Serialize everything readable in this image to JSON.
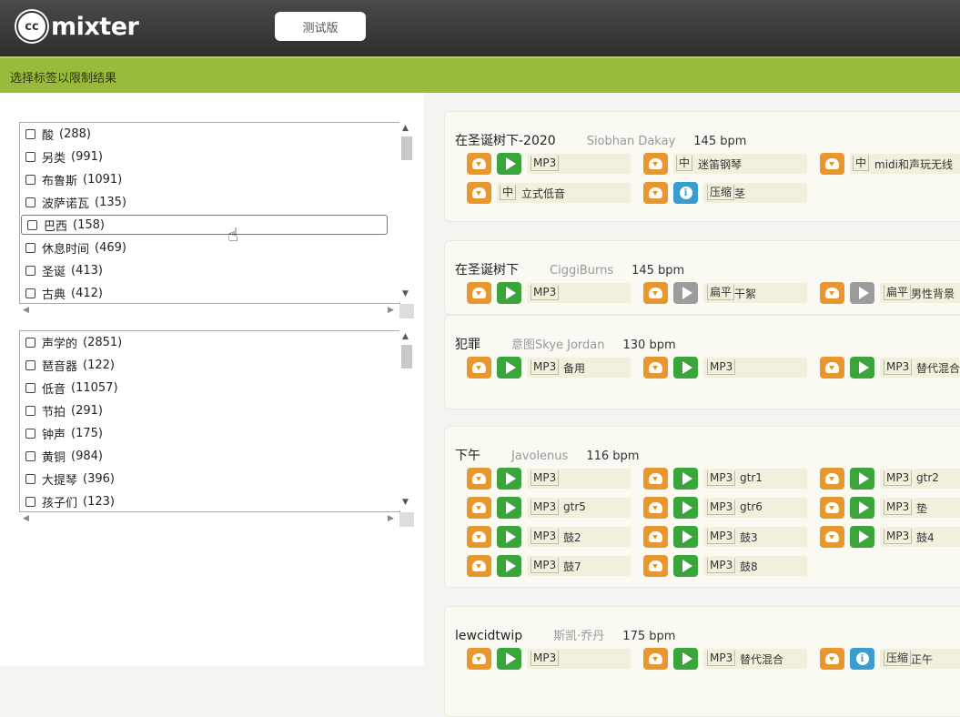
{
  "header": {
    "logo_cc": "cc",
    "logo_word": "mixter",
    "beta_button": "测试版"
  },
  "tagbar": {
    "label": "选择标签以限制结果"
  },
  "tag_list_1": [
    {
      "name": "酸",
      "count": "(288)"
    },
    {
      "name": "另类",
      "count": "(991)"
    },
    {
      "name": "布鲁斯",
      "count": "(1091)"
    },
    {
      "name": "波萨诺瓦",
      "count": "(135)"
    },
    {
      "name": "巴西",
      "count": "(158)"
    },
    {
      "name": "休息时间",
      "count": "(469)"
    },
    {
      "name": "圣诞",
      "count": "(413)"
    },
    {
      "name": "古典",
      "count": "(412)"
    }
  ],
  "tag_list_2": [
    {
      "name": "声学的",
      "count": "(2851)"
    },
    {
      "name": "琶音器",
      "count": "(122)"
    },
    {
      "name": "低音",
      "count": "(11057)"
    },
    {
      "name": "节拍",
      "count": "(291)"
    },
    {
      "name": "钟声",
      "count": "(175)"
    },
    {
      "name": "黄铜",
      "count": "(984)"
    },
    {
      "name": "大提琴",
      "count": "(396)"
    },
    {
      "name": "孩子们",
      "count": "(123)"
    }
  ],
  "icons": {
    "download": "download-cloud-icon",
    "play": "play-icon",
    "info": "info-icon",
    "scroll_up": "scroll-up-arrow-icon",
    "scroll_down": "scroll-down-arrow-icon",
    "cursor": "hand-pointer-icon"
  },
  "colors": {
    "download": "#e8962e",
    "play": "#3aa53a",
    "play_disabled": "#9c9c9c",
    "info": "#3a9dd1",
    "tagbar": "#9aba3c"
  },
  "tracks": [
    {
      "title": "在圣诞树下-2020",
      "artist": "Siobhan Dakay",
      "bpm": "145 bpm",
      "files": [
        {
          "play": "play",
          "format": "MP3",
          "label": ""
        },
        {
          "play": "none",
          "format": "中",
          "label": "迷笛钢琴"
        },
        {
          "play": "none",
          "format": "中",
          "label": "midi和声玩无线"
        },
        {
          "play": "none",
          "format": "中",
          "label": "立式低音"
        },
        {
          "play": "info",
          "format": "压缩",
          "label": "茎"
        }
      ]
    },
    {
      "title": "在圣诞树下",
      "artist": "CiggiBurns",
      "bpm": "145 bpm",
      "files": [
        {
          "play": "play",
          "format": "MP3",
          "label": ""
        },
        {
          "play": "gray",
          "format": "扁平",
          "label": "干絮"
        },
        {
          "play": "gray",
          "format": "扁平",
          "label": "男性背景"
        }
      ]
    },
    {
      "title": "犯罪",
      "artist": "意图Skye Jordan",
      "bpm": "130 bpm",
      "files": [
        {
          "play": "play",
          "format": "MP3",
          "label": "备用"
        },
        {
          "play": "play",
          "format": "MP3",
          "label": ""
        },
        {
          "play": "play",
          "format": "MP3",
          "label": "替代混合"
        }
      ]
    },
    {
      "title": "下午",
      "artist": "Javolenus",
      "bpm": "116 bpm",
      "files": [
        {
          "play": "play",
          "format": "MP3",
          "label": ""
        },
        {
          "play": "play",
          "format": "MP3",
          "label": "gtr1"
        },
        {
          "play": "play",
          "format": "MP3",
          "label": "gtr2"
        },
        {
          "play": "play",
          "format": "MP3",
          "label": "gtr5"
        },
        {
          "play": "play",
          "format": "MP3",
          "label": "gtr6"
        },
        {
          "play": "play",
          "format": "MP3",
          "label": "垫"
        },
        {
          "play": "play",
          "format": "MP3",
          "label": "鼓2"
        },
        {
          "play": "play",
          "format": "MP3",
          "label": "鼓3"
        },
        {
          "play": "play",
          "format": "MP3",
          "label": "鼓4"
        },
        {
          "play": "play",
          "format": "MP3",
          "label": "鼓7"
        },
        {
          "play": "play",
          "format": "MP3",
          "label": "鼓8"
        }
      ]
    },
    {
      "title": "lewcidtwip",
      "artist": "斯凯·乔丹",
      "bpm": "175 bpm",
      "files": [
        {
          "play": "play",
          "format": "MP3",
          "label": ""
        },
        {
          "play": "play",
          "format": "MP3",
          "label": "替代混合"
        },
        {
          "play": "info",
          "format": "压缩",
          "label": "正午"
        }
      ]
    }
  ]
}
